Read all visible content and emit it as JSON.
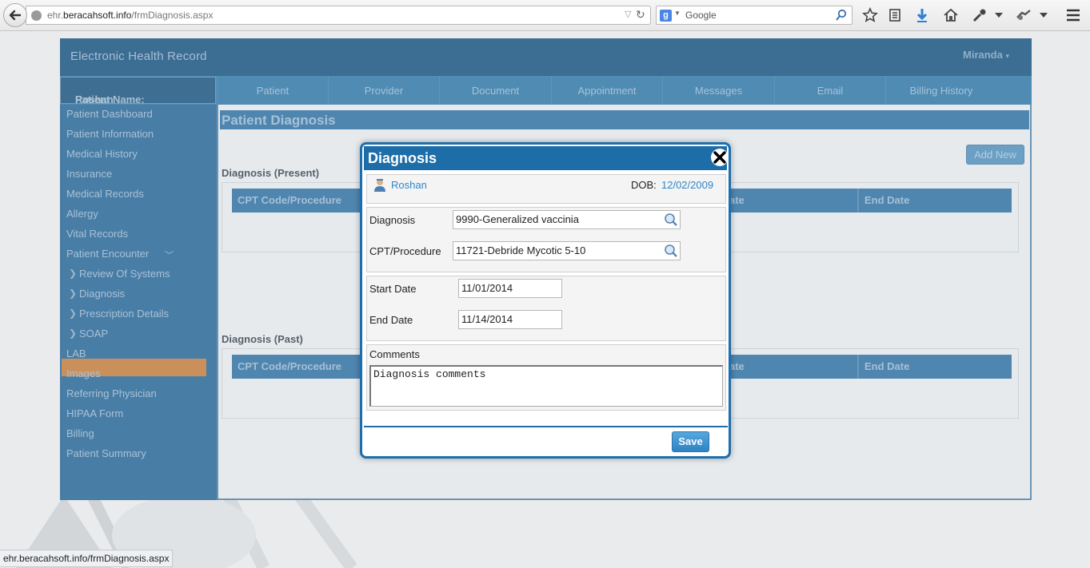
{
  "browser": {
    "url_prefix": "ehr.",
    "url_domain": "beracahsoft.info",
    "url_path": "/frmDiagnosis.aspx",
    "search_placeholder": "Google",
    "search_engine_glyph": "g",
    "status_url": "ehr.beracahsoft.info/frmDiagnosis.aspx"
  },
  "app": {
    "title": "Electronic Health Record",
    "user": "Miranda",
    "patient_label": "Patient Name:",
    "patient_name": "Roshan"
  },
  "nav_tabs": [
    "Patient",
    "Provider",
    "Document",
    "Appointment",
    "Messages",
    "Email",
    "Billing History"
  ],
  "sidebar": {
    "items": [
      "Patient Dashboard",
      "Patient Information",
      "Medical History",
      "Insurance",
      "Medical Records",
      "Allergy",
      "Vital Records",
      "Patient Encounter"
    ],
    "sub_items": [
      "Review Of Systems",
      "Diagnosis",
      "Prescription Details",
      "SOAP"
    ],
    "active_sub": "Diagnosis",
    "items_after": [
      "LAB",
      "Images",
      "Referring Physician",
      "HIPAA Form",
      "Billing",
      "Patient Summary"
    ]
  },
  "content": {
    "title": "Patient Diagnosis",
    "add_new": "Add New",
    "present_label": "Diagnosis (Present)",
    "past_label": "Diagnosis (Past)",
    "columns": {
      "cpt": "CPT Code/Procedure",
      "start_partial": "ate",
      "end": "End Date"
    }
  },
  "modal": {
    "title": "Diagnosis",
    "patient_name": "Roshan",
    "dob_label": "DOB:",
    "dob_value": "12/02/2009",
    "diagnosis_label": "Diagnosis",
    "diagnosis_value": "9990-Generalized vaccinia",
    "cpt_label": "CPT/Procedure",
    "cpt_value": "11721-Debride Mycotic 5-10",
    "start_label": "Start Date",
    "start_value": "11/01/2014",
    "end_label": "End Date",
    "end_value": "11/14/2014",
    "comments_label": "Comments",
    "comments_value": "Diagnosis comments",
    "save_label": "Save"
  },
  "colors": {
    "modal_border": "#1c6fae",
    "save_button": "#2e83c3",
    "link": "#2d87c8",
    "active_sidebar": "#c9905c"
  }
}
